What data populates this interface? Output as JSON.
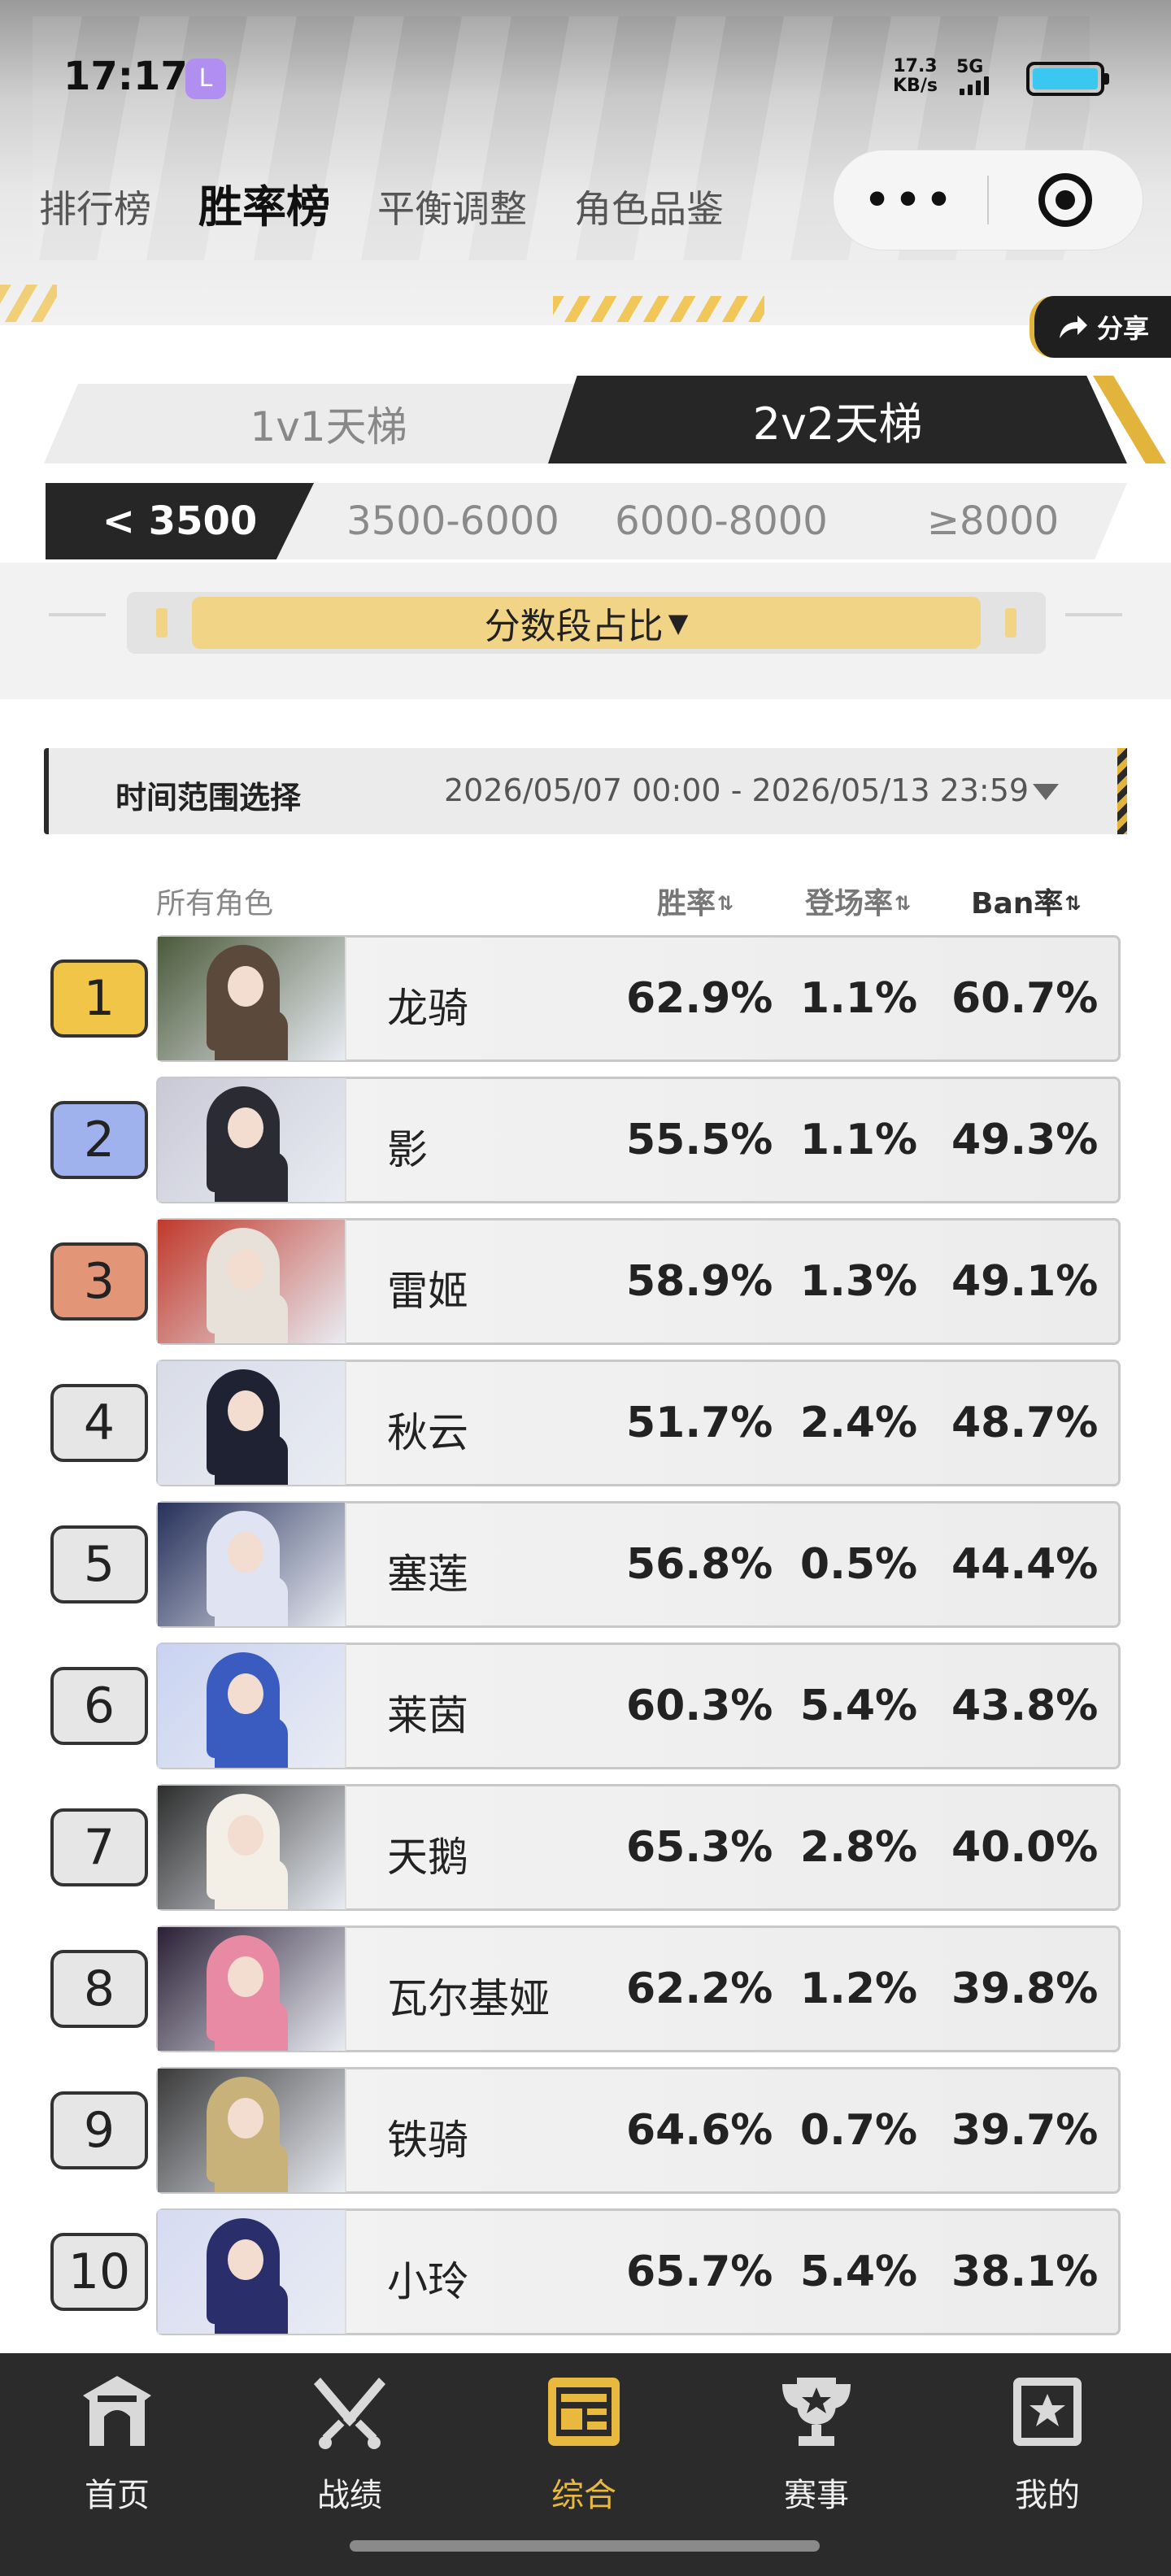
{
  "status": {
    "time": "17:17",
    "app_icon": "L",
    "net_speed": "17.3",
    "net_unit": "KB/s",
    "network": "5G"
  },
  "top_nav": {
    "items": [
      {
        "label": "排行榜"
      },
      {
        "label": "胜率榜"
      },
      {
        "label": "平衡调整"
      },
      {
        "label": "角色品鉴"
      }
    ],
    "active_index": 1
  },
  "capsule": {
    "more_label": "•••"
  },
  "share_label": "分享",
  "ladder_tabs": [
    {
      "label": "1v1天梯"
    },
    {
      "label": "2v2天梯"
    }
  ],
  "ladder_active": 1,
  "score_tabs": [
    {
      "label": "< 3500"
    },
    {
      "label": "3500-6000"
    },
    {
      "label": "6000-8000"
    },
    {
      "label": "≥8000"
    }
  ],
  "score_active": 0,
  "ratio_label": "分数段占比",
  "time_filter": {
    "label": "时间范围选择",
    "range": "2026/05/07 00:00 - 2026/05/13 23:59"
  },
  "list_header": {
    "role": "所有角色",
    "win_rate": "胜率",
    "pick_rate": "登场率",
    "ban_rate": "Ban率"
  },
  "rows": [
    {
      "rank": "1",
      "name": "龙骑",
      "win": "62.9%",
      "pick": "1.1%",
      "ban": "60.7%"
    },
    {
      "rank": "2",
      "name": "影",
      "win": "55.5%",
      "pick": "1.1%",
      "ban": "49.3%"
    },
    {
      "rank": "3",
      "name": "雷姬",
      "win": "58.9%",
      "pick": "1.3%",
      "ban": "49.1%"
    },
    {
      "rank": "4",
      "name": "秋云",
      "win": "51.7%",
      "pick": "2.4%",
      "ban": "48.7%"
    },
    {
      "rank": "5",
      "name": "塞莲",
      "win": "56.8%",
      "pick": "0.5%",
      "ban": "44.4%"
    },
    {
      "rank": "6",
      "name": "莱茵",
      "win": "60.3%",
      "pick": "5.4%",
      "ban": "43.8%"
    },
    {
      "rank": "7",
      "name": "天鹅",
      "win": "65.3%",
      "pick": "2.8%",
      "ban": "40.0%"
    },
    {
      "rank": "8",
      "name": "瓦尔基娅",
      "win": "62.2%",
      "pick": "1.2%",
      "ban": "39.8%"
    },
    {
      "rank": "9",
      "name": "铁骑",
      "win": "64.6%",
      "pick": "0.7%",
      "ban": "39.7%"
    },
    {
      "rank": "10",
      "name": "小玲",
      "win": "65.7%",
      "pick": "5.4%",
      "ban": "38.1%"
    }
  ],
  "bottom_nav": [
    {
      "label": "首页",
      "icon": "home-icon"
    },
    {
      "label": "战绩",
      "icon": "crossed-swords-icon"
    },
    {
      "label": "综合",
      "icon": "dashboard-icon"
    },
    {
      "label": "赛事",
      "icon": "trophy-icon"
    },
    {
      "label": "我的",
      "icon": "profile-icon"
    }
  ],
  "bottom_active": 2,
  "colors": {
    "accent": "#e8b93e",
    "dark": "#262626",
    "rank1": "#f1c548",
    "rank2": "#9fb2ee",
    "rank3": "#e29577"
  }
}
